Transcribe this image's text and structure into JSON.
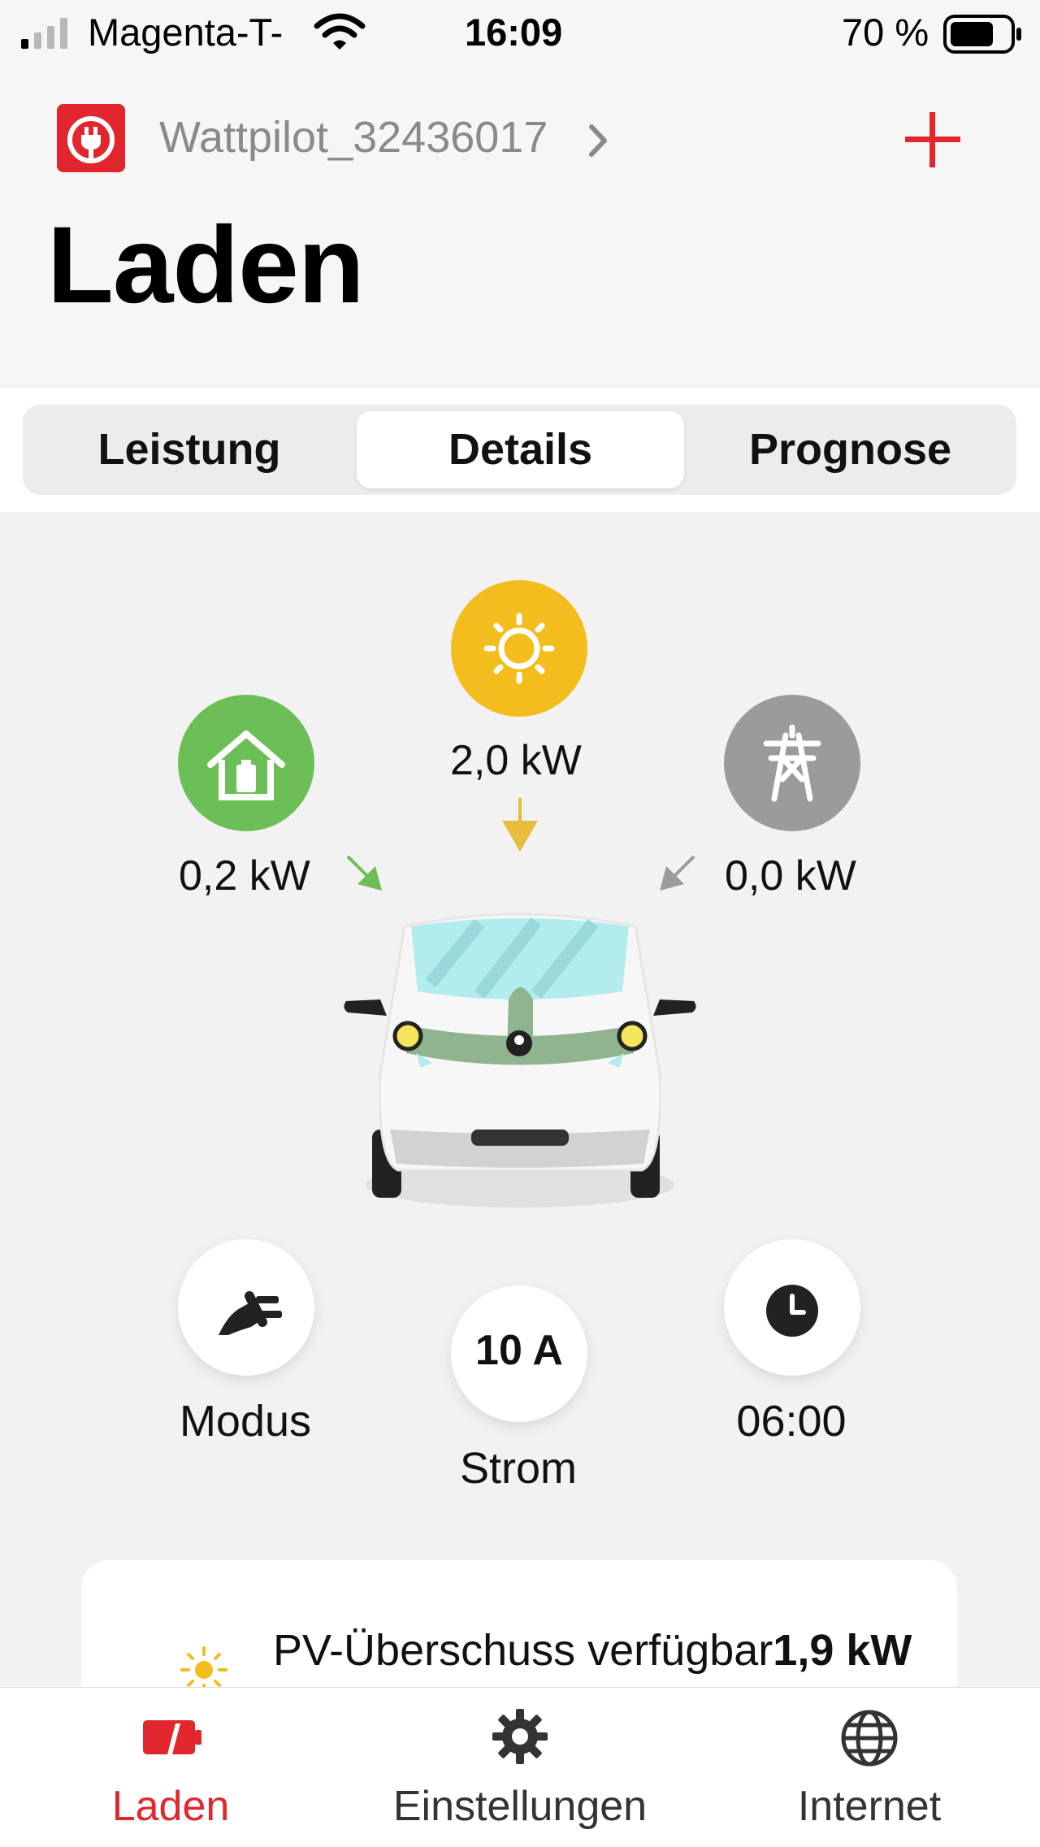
{
  "status_bar": {
    "carrier": "Magenta-T-",
    "time": "16:09",
    "battery_percent": "70 %"
  },
  "header": {
    "device_name": "Wattpilot_32436017",
    "title": "Laden",
    "add_icon": "plus-icon"
  },
  "segments": {
    "items": [
      "Leistung",
      "Details",
      "Prognose"
    ],
    "active": "Details"
  },
  "flow": {
    "solar": {
      "value": "2,0 kW",
      "color": "#f4bd1e"
    },
    "home": {
      "value": "0,2 kW",
      "color": "#6cbf56"
    },
    "grid": {
      "value": "0,0 kW",
      "color": "#9b9b9b"
    }
  },
  "controls": {
    "mode": {
      "label": "Modus",
      "icon": "plug-icon"
    },
    "current": {
      "value": "10 A",
      "label": "Strom"
    },
    "timer": {
      "value": "06:00",
      "icon": "clock-icon"
    }
  },
  "card": {
    "text": "PV-Überschuss verfügbar",
    "value": "1,9 kW"
  },
  "tabbar": {
    "items": [
      "Laden",
      "Einstellungen",
      "Internet"
    ],
    "active": "Laden",
    "accent": "#e2262d"
  }
}
